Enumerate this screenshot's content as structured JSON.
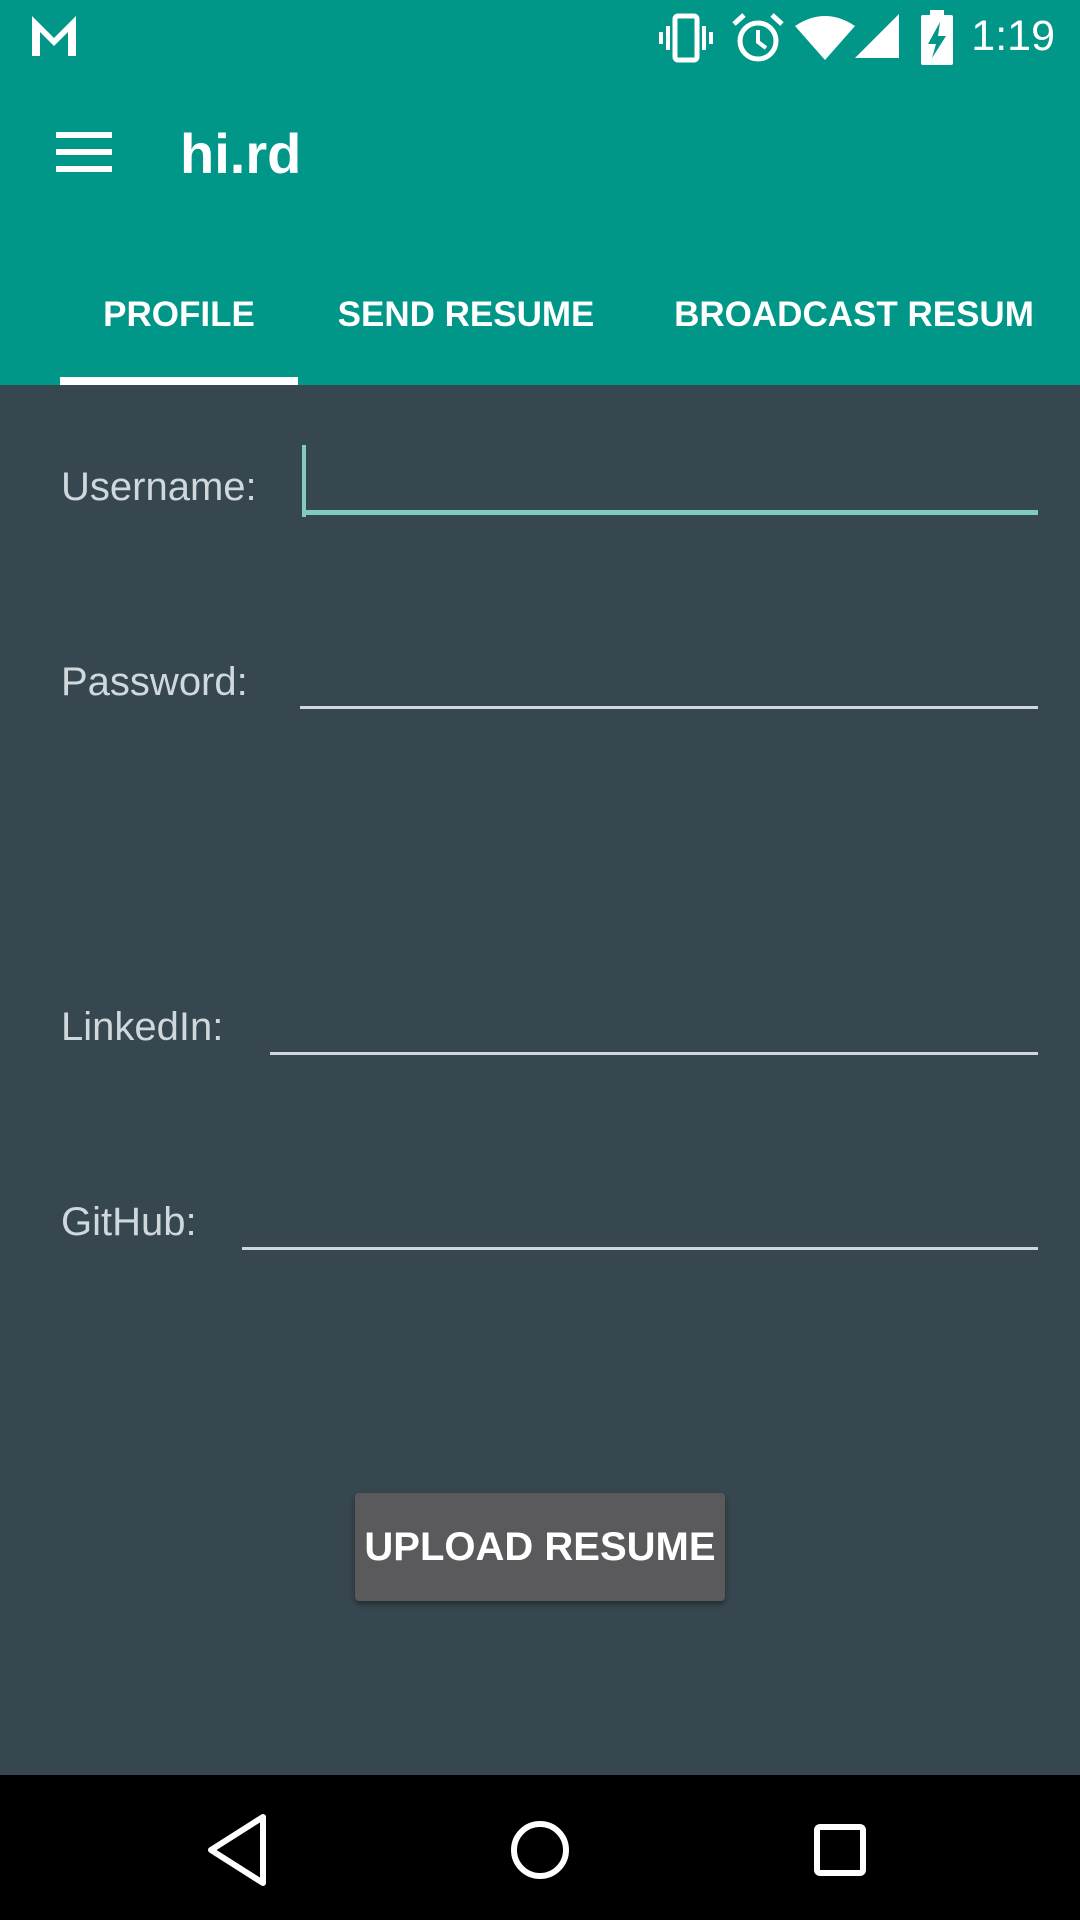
{
  "status_bar": {
    "time": "1:19",
    "icons": [
      "gmail-icon",
      "vibrate-icon",
      "alarm-icon",
      "wifi-icon",
      "cell-signal-icon",
      "battery-charging-icon"
    ]
  },
  "toolbar": {
    "title": "hi.rd",
    "menu_icon": "hamburger-menu-icon"
  },
  "tabs": [
    {
      "label": "PROFILE",
      "selected": true
    },
    {
      "label": "SEND RESUME",
      "selected": false
    },
    {
      "label": "BROADCAST RESUM",
      "selected": false
    }
  ],
  "form": {
    "username_label": "Username:",
    "username_value": "",
    "password_label": "Password:",
    "password_value": "",
    "linkedin_label": "LinkedIn:",
    "linkedin_value": "",
    "github_label": "GitHub:",
    "github_value": "",
    "upload_button": "UPLOAD RESUME"
  },
  "nav_bar": {
    "back": "back-icon",
    "home": "home-icon",
    "recents": "recents-icon"
  },
  "colors": {
    "primary": "#009688",
    "background": "#37474f",
    "accent": "#80cbc4",
    "button": "#5a5a5c"
  }
}
